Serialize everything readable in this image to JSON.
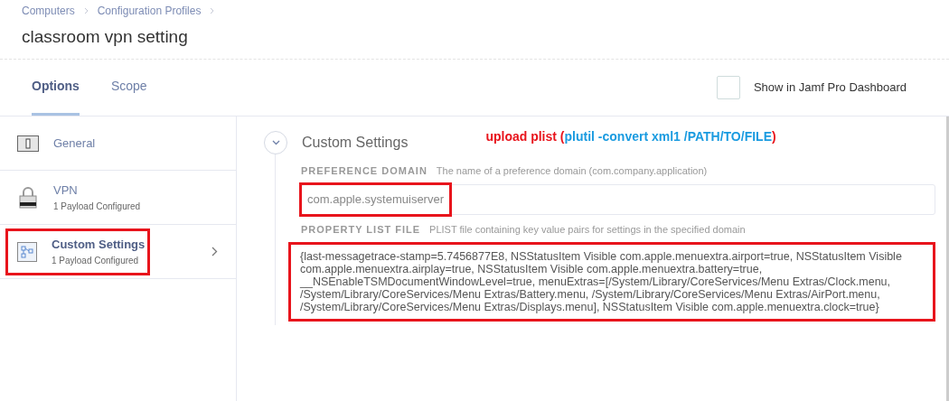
{
  "breadcrumbs": [
    "Computers",
    "Configuration Profiles"
  ],
  "title": "classroom vpn setting",
  "tabs": [
    {
      "label": "Options",
      "selected": true
    },
    {
      "label": "Scope",
      "selected": false
    }
  ],
  "dashboard": {
    "label": "Show in Jamf Pro Dashboard",
    "checked": false
  },
  "sidebar": {
    "items": [
      {
        "kind": "switch",
        "name": "General",
        "highlighted": false,
        "selected": false
      },
      {
        "kind": "lock",
        "name": "VPN",
        "subtitle": "1 Payload Configured",
        "highlighted": false,
        "selected": false
      },
      {
        "kind": "custom",
        "name": "Custom Settings",
        "subtitle": "1 Payload Configured",
        "highlighted": true,
        "selected": true
      }
    ]
  },
  "section": {
    "title": "Custom Settings",
    "expanded": true,
    "annotation": [
      {
        "text": "upload plist ",
        "color": "#e8141c"
      },
      {
        "text": "(",
        "color": "#e8141c"
      },
      {
        "text": "plutil -convert xml1 /PATH/TO/FILE",
        "color": "#1a9be0"
      },
      {
        "text": ")",
        "color": "#e8141c"
      }
    ],
    "fields": [
      {
        "label": "PREFERENCE DOMAIN",
        "hint": "The name of a preference domain (com.company.application)",
        "value": "com.apple.systemuiserver",
        "highlighted": true
      },
      {
        "label": "PROPERTY LIST FILE",
        "hint": "PLIST file containing key value pairs for settings in the specified domain",
        "value": "{last-messagetrace-stamp=5.7456877E8, NSStatusItem Visible com.apple.menuextra.airport=true, NSStatusItem Visible com.apple.menuextra.airplay=true, NSStatusItem Visible com.apple.menuextra.battery=true, __NSEnableTSMDocumentWindowLevel=true, menuExtras=[/System/Library/CoreServices/Menu Extras/Clock.menu, /System/Library/CoreServices/Menu Extras/Battery.menu, /System/Library/CoreServices/Menu Extras/AirPort.menu, /System/Library/CoreServices/Menu Extras/Displays.menu], NSStatusItem Visible com.apple.menuextra.clock=true}",
        "highlighted": true
      }
    ]
  }
}
